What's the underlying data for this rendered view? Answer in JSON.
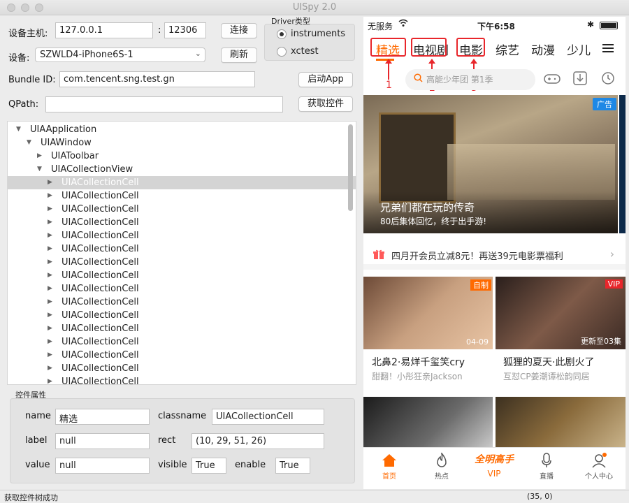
{
  "window": {
    "title": "UISpy 2.0"
  },
  "form": {
    "host_label": "设备主机:",
    "host_value": "127.0.0.1",
    "port_sep": ":",
    "port_value": "12306",
    "connect_label": "连接",
    "device_label": "设备:",
    "device_value": "SZWLD4-iPhone6S-1",
    "refresh_label": "刷新",
    "bundle_label": "Bundle ID:",
    "bundle_value": "com.tencent.sng.test.gn",
    "launch_label": "启动App",
    "qpath_label": "QPath:",
    "qpath_value": "",
    "get_controls_label": "获取控件",
    "driver_title": "Driver类型",
    "driver_options": [
      "instruments",
      "xctest"
    ],
    "driver_selected": "instruments"
  },
  "tree": {
    "nodes": [
      {
        "label": "UIAApplication",
        "level": 0,
        "expanded": true
      },
      {
        "label": "UIAWindow",
        "level": 1,
        "expanded": true
      },
      {
        "label": "UIAToolbar",
        "level": 2,
        "expanded": false
      },
      {
        "label": "UIACollectionView",
        "level": 2,
        "expanded": true
      },
      {
        "label": "UIACollectionCell",
        "level": 3,
        "expanded": false,
        "selected": true
      },
      {
        "label": "UIACollectionCell",
        "level": 3,
        "expanded": false
      },
      {
        "label": "UIACollectionCell",
        "level": 3,
        "expanded": false
      },
      {
        "label": "UIACollectionCell",
        "level": 3,
        "expanded": false
      },
      {
        "label": "UIACollectionCell",
        "level": 3,
        "expanded": false
      },
      {
        "label": "UIACollectionCell",
        "level": 3,
        "expanded": false
      },
      {
        "label": "UIACollectionCell",
        "level": 3,
        "expanded": false
      },
      {
        "label": "UIACollectionCell",
        "level": 3,
        "expanded": false
      },
      {
        "label": "UIACollectionCell",
        "level": 3,
        "expanded": false
      },
      {
        "label": "UIACollectionCell",
        "level": 3,
        "expanded": false
      },
      {
        "label": "UIACollectionCell",
        "level": 3,
        "expanded": false
      },
      {
        "label": "UIACollectionCell",
        "level": 3,
        "expanded": false
      },
      {
        "label": "UIACollectionCell",
        "level": 3,
        "expanded": false
      },
      {
        "label": "UIACollectionCell",
        "level": 3,
        "expanded": false
      },
      {
        "label": "UIACollectionCell",
        "level": 3,
        "expanded": false
      },
      {
        "label": "UIACollectionCell",
        "level": 3,
        "expanded": false
      },
      {
        "label": "UIACollectionCell",
        "level": 3,
        "expanded": false
      },
      {
        "label": "UIACollectionCell",
        "level": 3,
        "expanded": false
      },
      {
        "label": "UIACollectionCell",
        "level": 3,
        "expanded": false
      },
      {
        "label": "UIACollectionCell",
        "level": 3,
        "expanded": false
      }
    ]
  },
  "props": {
    "title": "控件属性",
    "name_label": "name",
    "name_value": "精选",
    "classname_label": "classname",
    "classname_value": "UIACollectionCell",
    "label_label": "label",
    "label_value": "null",
    "rect_label": "rect",
    "rect_value": "(10, 29, 51, 26)",
    "value_label": "value",
    "value_value": "null",
    "visible_label": "visible",
    "visible_value": "True",
    "enable_label": "enable",
    "enable_value": "True"
  },
  "status": {
    "message": "获取控件树成功",
    "coords": "(35, 0)"
  },
  "phone": {
    "carrier": "无服务",
    "time": "下午6:58",
    "tabs": [
      "精选",
      "电视剧",
      "电影",
      "综艺",
      "动漫",
      "少儿"
    ],
    "annotations": [
      "1",
      "2",
      "3"
    ],
    "search_placeholder": "高能少年团 第1季",
    "banner_tag": "广告",
    "banner_title": "兄弟们都在玩的传奇",
    "banner_subtitle": "80后集体回忆，终于出手游!",
    "promo_text": "四月开会员立减8元！再送39元电影票福利",
    "cards": [
      {
        "badge": "自制",
        "corner": "04-09",
        "title": "北鼻2·易烊千玺笑cry",
        "subtitle": "甜翻！小彤狂亲Jackson"
      },
      {
        "badge": "VIP",
        "corner": "更新至03集",
        "title": "狐狸的夏天·此剧火了",
        "subtitle": "互怼CP姜潮谭松韵同居"
      }
    ],
    "tabbar": [
      "首页",
      "热点",
      "VIP",
      "直播",
      "个人中心"
    ],
    "vip_logo": "全明高手",
    "colors": {
      "accent": "#ff6a00",
      "annotation": "#e8262b"
    }
  }
}
